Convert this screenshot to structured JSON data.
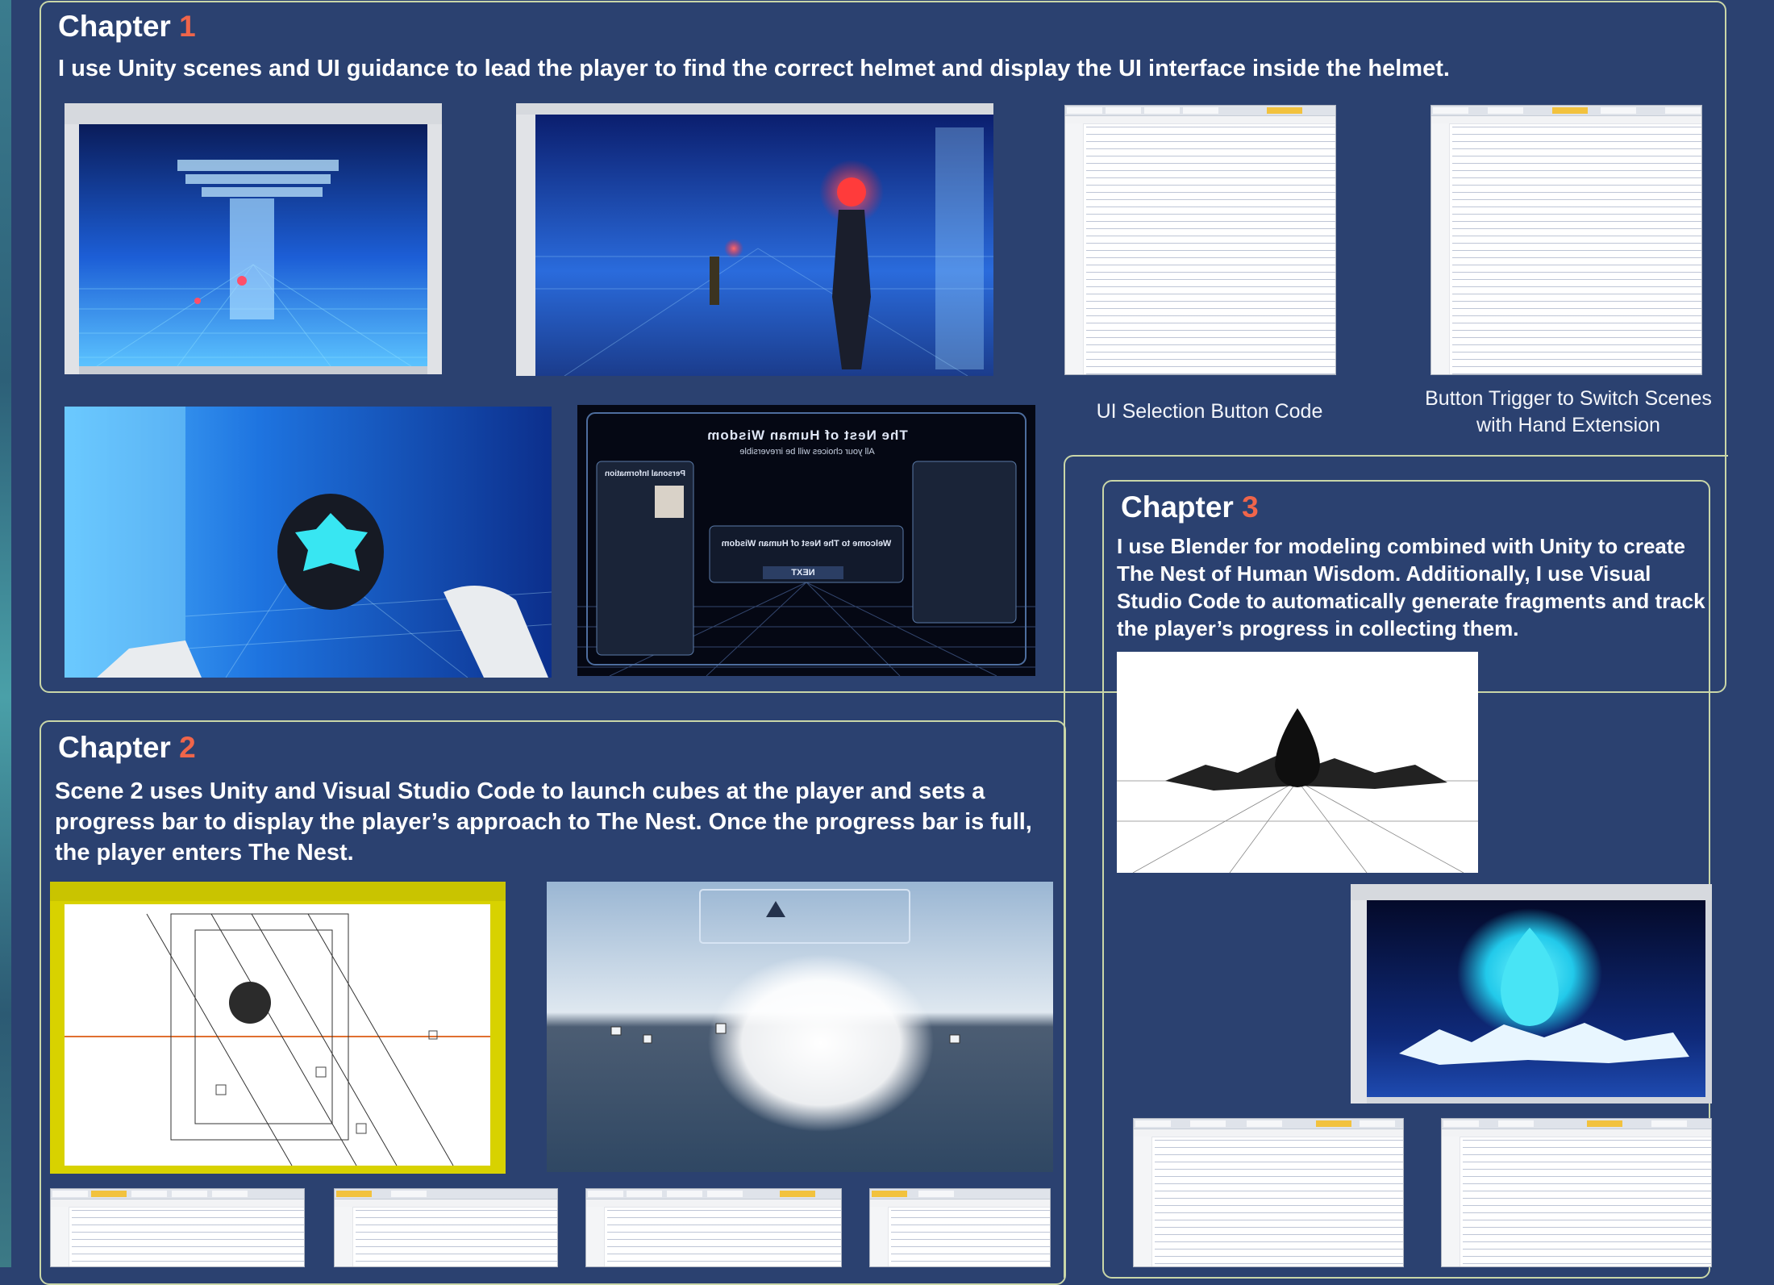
{
  "chapter1": {
    "heading_word": "Chapter",
    "number": "1",
    "description": "I use Unity scenes and UI guidance to lead the player to find the correct helmet and display the UI interface inside the helmet.",
    "captions": [
      "UI Selection Button Code",
      "Button Trigger to Switch Scenes with Hand Extension"
    ]
  },
  "chapter2": {
    "heading_word": "Chapter",
    "number": "2",
    "description": "Scene 2 uses Unity and Visual Studio Code to launch cubes at the player and sets a progress bar to display the player’s approach to The Nest. Once the progress bar is full, the player enters The Nest."
  },
  "chapter3": {
    "heading_word": "Chapter",
    "number": "3",
    "description": "I use Blender for modeling combined with Unity to create The Nest of Human Wisdom. Additionally, I use Visual Studio Code to automatically generate fragments and track the player’s progress in collecting them."
  },
  "hud": {
    "title": "The Nest of Human Wisdom",
    "warning": "All your choices will be irreversible",
    "profile_title": "Personal Information",
    "welcome": "Welcome to The Nest of Human Wisdom",
    "next_label": "NEXT"
  },
  "colors": {
    "background": "#2b4170",
    "border": "#c9d6a8",
    "accent_number": "#f0654a",
    "unity_yellow": "#d8d200"
  }
}
